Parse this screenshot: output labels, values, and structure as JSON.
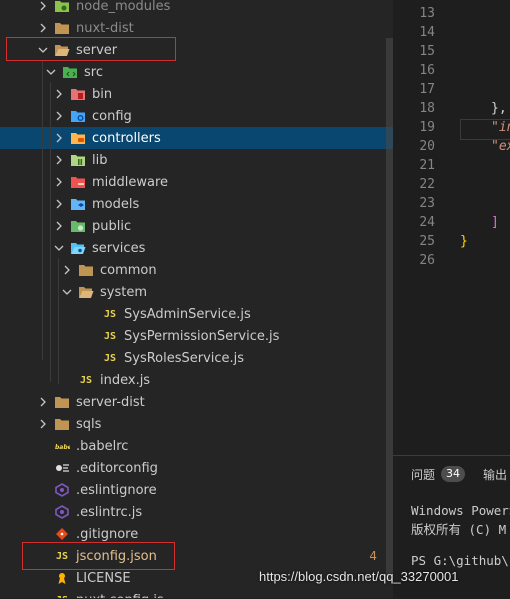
{
  "explorer": {
    "items": [
      {
        "label": "node_modules",
        "chev": "right",
        "icon": "node-modules-folder-icon",
        "muted": true
      },
      {
        "label": "nuxt-dist",
        "chev": "right",
        "icon": "folder-icon",
        "muted": true
      },
      {
        "label": "server",
        "chev": "down",
        "icon": "folder-open-icon"
      },
      {
        "label": "src",
        "chev": "down",
        "icon": "src-folder-icon"
      },
      {
        "label": "bin",
        "chev": "right",
        "icon": "bin-folder-icon"
      },
      {
        "label": "config",
        "chev": "right",
        "icon": "config-folder-icon"
      },
      {
        "label": "controllers",
        "chev": "right",
        "icon": "controllers-folder-icon",
        "selected": true
      },
      {
        "label": "lib",
        "chev": "right",
        "icon": "lib-folder-icon"
      },
      {
        "label": "middleware",
        "chev": "right",
        "icon": "middleware-folder-icon"
      },
      {
        "label": "models",
        "chev": "right",
        "icon": "models-folder-icon"
      },
      {
        "label": "public",
        "chev": "right",
        "icon": "public-folder-icon"
      },
      {
        "label": "services",
        "chev": "down",
        "icon": "services-folder-icon"
      },
      {
        "label": "common",
        "chev": "right",
        "icon": "folder-icon"
      },
      {
        "label": "system",
        "chev": "down",
        "icon": "folder-open-icon"
      },
      {
        "label": "SysAdminService.js",
        "chev": "none",
        "icon": "js-file-icon"
      },
      {
        "label": "SysPermissionService.js",
        "chev": "none",
        "icon": "js-file-icon"
      },
      {
        "label": "SysRolesService.js",
        "chev": "none",
        "icon": "js-file-icon"
      },
      {
        "label": "index.js",
        "chev": "none",
        "icon": "js-file-icon"
      },
      {
        "label": "server-dist",
        "chev": "right",
        "icon": "folder-icon"
      },
      {
        "label": "sqls",
        "chev": "right",
        "icon": "folder-icon"
      },
      {
        "label": ".babelrc",
        "chev": "none",
        "icon": "babel-icon"
      },
      {
        "label": ".editorconfig",
        "chev": "none",
        "icon": "editorconfig-icon"
      },
      {
        "label": ".eslintignore",
        "chev": "none",
        "icon": "eslint-icon"
      },
      {
        "label": ".eslintrc.js",
        "chev": "none",
        "icon": "eslint-icon"
      },
      {
        "label": ".gitignore",
        "chev": "none",
        "icon": "git-icon"
      },
      {
        "label": "jsconfig.json",
        "chev": "none",
        "icon": "js-file-icon",
        "orange": true,
        "count": "4"
      },
      {
        "label": "LICENSE",
        "chev": "none",
        "icon": "license-icon"
      },
      {
        "label": "nuxt.config.js",
        "chev": "none",
        "icon": "js-file-icon"
      }
    ]
  },
  "editor": {
    "line_numbers": [
      "13",
      "14",
      "15",
      "16",
      "17",
      "18",
      "19",
      "20",
      "21",
      "22",
      "23",
      "24",
      "25",
      "26"
    ],
    "code": {
      "l18": "},",
      "l19": "\"in",
      "l20": "\"ex",
      "l24": "]",
      "l25": "}"
    }
  },
  "panel": {
    "problems_label": "问题",
    "problems_count": "34",
    "output_label": "输出",
    "terminal_line1": "Windows PowerS",
    "terminal_line2": "版权所有 (C) M",
    "terminal_prompt": "PS G:\\github\\b"
  },
  "watermark": "https://blog.csdn.net/qq_33270001",
  "colors": {
    "selection": "#094771",
    "annotation_box": "#d32f2f",
    "js_badge": "#e8d44d",
    "modified_file": "#e2c08d"
  }
}
